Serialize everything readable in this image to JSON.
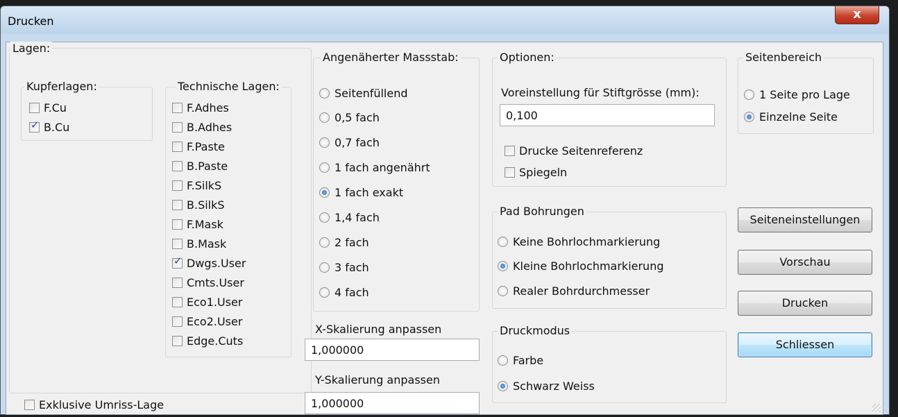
{
  "window": {
    "title": "Drucken",
    "close_symbol": "x"
  },
  "lagen": {
    "label": "Lagen:",
    "kupfer": {
      "label": "Kupferlagen:",
      "items": [
        {
          "label": "F.Cu",
          "checked": false
        },
        {
          "label": "B.Cu",
          "checked": true
        }
      ]
    },
    "technisch": {
      "label": "Technische Lagen:",
      "items": [
        {
          "label": "F.Adhes",
          "checked": false
        },
        {
          "label": "B.Adhes",
          "checked": false
        },
        {
          "label": "F.Paste",
          "checked": false
        },
        {
          "label": "B.Paste",
          "checked": false
        },
        {
          "label": "F.SilkS",
          "checked": false
        },
        {
          "label": "B.SilkS",
          "checked": false
        },
        {
          "label": "F.Mask",
          "checked": false
        },
        {
          "label": "B.Mask",
          "checked": false
        },
        {
          "label": "Dwgs.User",
          "checked": true
        },
        {
          "label": "Cmts.User",
          "checked": false
        },
        {
          "label": "Eco1.User",
          "checked": false
        },
        {
          "label": "Eco2.User",
          "checked": false
        },
        {
          "label": "Edge.Cuts",
          "checked": false
        }
      ]
    },
    "exklusive": {
      "label": "Exklusive Umriss-Lage",
      "checked": false
    }
  },
  "massstab": {
    "label": "Angenäherter Massstab:",
    "options": [
      {
        "label": "Seitenfüllend",
        "selected": false
      },
      {
        "label": "0,5 fach",
        "selected": false
      },
      {
        "label": "0,7 fach",
        "selected": false
      },
      {
        "label": "1 fach angenährt",
        "selected": false
      },
      {
        "label": "1 fach exakt",
        "selected": true
      },
      {
        "label": "1,4 fach",
        "selected": false
      },
      {
        "label": "2 fach",
        "selected": false
      },
      {
        "label": "3 fach",
        "selected": false
      },
      {
        "label": "4 fach",
        "selected": false
      }
    ]
  },
  "skalierung": {
    "x_label": "X-Skalierung anpassen",
    "x_value": "1,000000",
    "y_label": "Y-Skalierung anpassen",
    "y_value": "1,000000"
  },
  "optionen": {
    "label": "Optionen:",
    "stift_label": "Voreinstellung für Stiftgrösse (mm):",
    "stift_value": "0,100",
    "seitenreferenz": {
      "label": "Drucke Seitenreferenz",
      "checked": false
    },
    "spiegeln": {
      "label": "Spiegeln",
      "checked": false
    }
  },
  "pad": {
    "label": "Pad Bohrungen",
    "options": [
      {
        "label": "Keine Bohrlochmarkierung",
        "selected": false
      },
      {
        "label": "Kleine Bohrlochmarkierung",
        "selected": true
      },
      {
        "label": "Realer Bohrdurchmesser",
        "selected": false
      }
    ]
  },
  "modus": {
    "label": "Druckmodus",
    "options": [
      {
        "label": "Farbe",
        "selected": false
      },
      {
        "label": "Schwarz Weiss",
        "selected": true
      }
    ]
  },
  "seitenbereich": {
    "label": "Seitenbereich",
    "options": [
      {
        "label": "1 Seite pro Lage",
        "selected": false
      },
      {
        "label": "Einzelne Seite",
        "selected": true
      }
    ]
  },
  "buttons": {
    "seiteneinstellungen": "Seiteneinstellungen",
    "vorschau": "Vorschau",
    "drucken": "Drucken",
    "schliessen": "Schliessen"
  },
  "colors": {
    "accent": "#1f5fb8",
    "check": "#2c4a9c",
    "default_button": "#a7d9f5",
    "close_button": "#c7432d"
  }
}
